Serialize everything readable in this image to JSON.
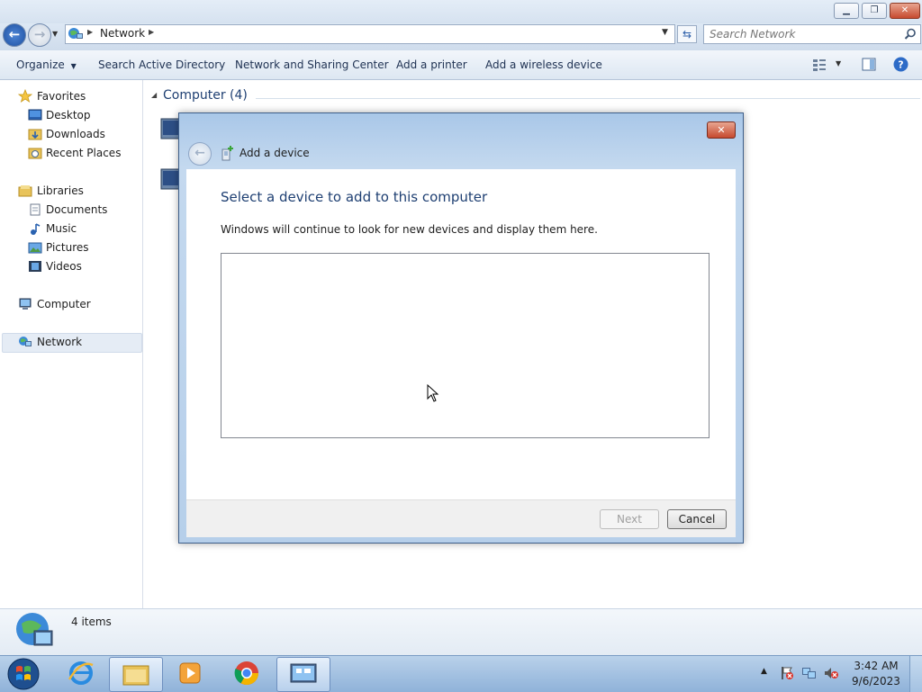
{
  "window": {
    "title": ""
  },
  "address": {
    "root_label": "Network",
    "search_placeholder": "Search Network"
  },
  "toolbar": {
    "organize": "Organize",
    "search_ad": "Search Active Directory",
    "network_sharing": "Network and Sharing Center",
    "add_printer": "Add a printer",
    "add_wireless": "Add a wireless device"
  },
  "navpane": {
    "favorites": "Favorites",
    "desktop": "Desktop",
    "downloads": "Downloads",
    "recent": "Recent Places",
    "libraries": "Libraries",
    "documents": "Documents",
    "music": "Music",
    "pictures": "Pictures",
    "videos": "Videos",
    "computer": "Computer",
    "network": "Network"
  },
  "content": {
    "group_header": "Computer (4)"
  },
  "details": {
    "count": "4 items"
  },
  "dialog": {
    "title": "Add a device",
    "heading": "Select a device to add to this computer",
    "description": "Windows will continue to look for new devices and display them here.",
    "next_label": "Next",
    "cancel_label": "Cancel",
    "close_glyph": "✕"
  },
  "taskbar": {
    "time": "3:42 AM",
    "date": "9/6/2023"
  },
  "colors": {
    "accent": "#1e3f72",
    "link": "#1e3152",
    "dialog_heading": "#1e3f72"
  }
}
